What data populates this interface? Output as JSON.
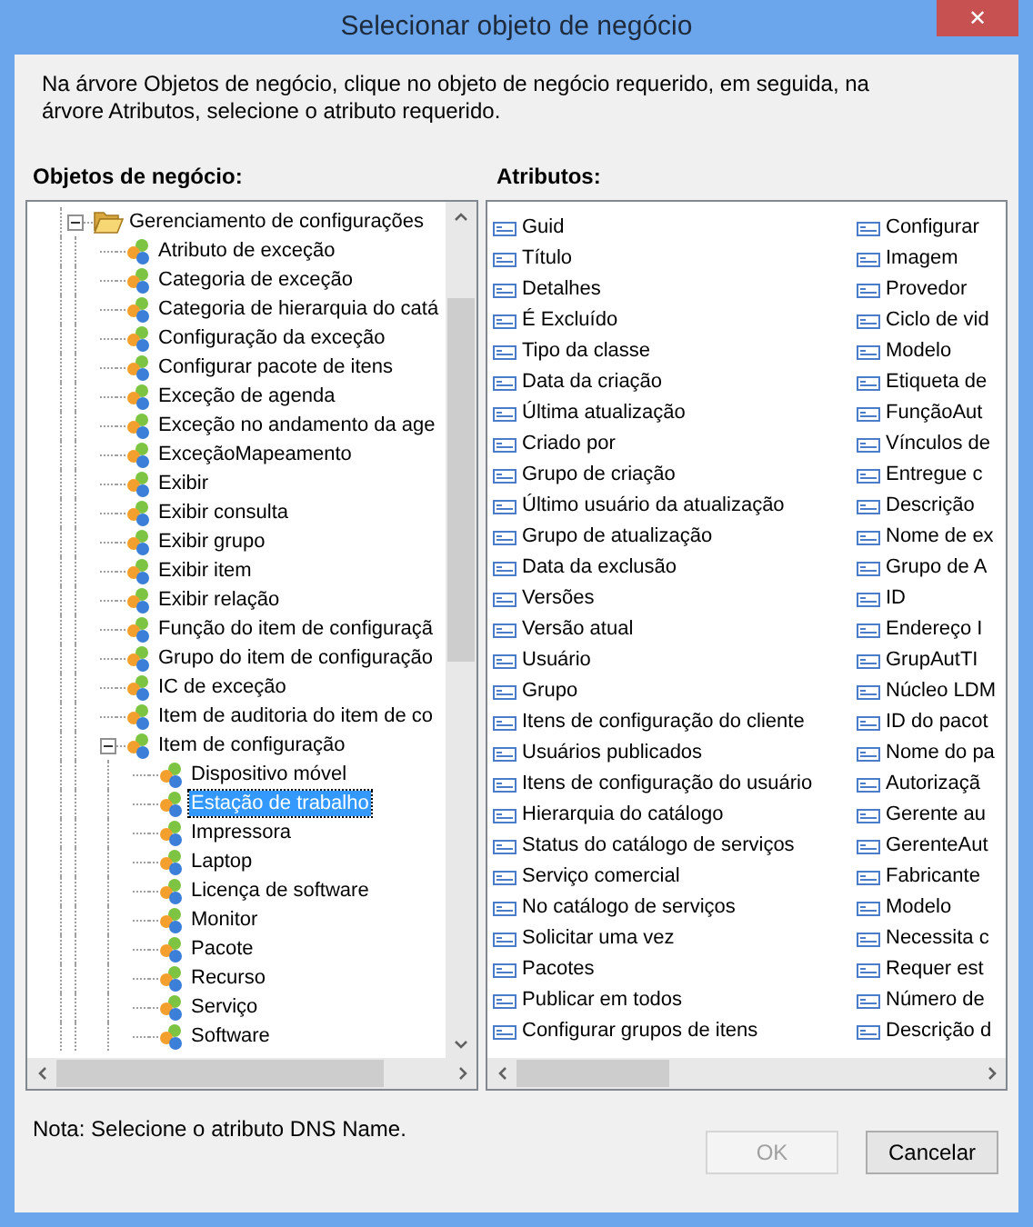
{
  "window": {
    "title": "Selecionar objeto de negócio",
    "close": "✕"
  },
  "instructions": "Na árvore Objetos de negócio, clique no objeto de negócio requerido, em seguida, na árvore Atributos, selecione o atributo requerido.",
  "business_objects": {
    "label": "Objetos de negócio:",
    "tree": [
      {
        "label": "Gerenciamento de configurações",
        "kind": "folder",
        "expanded": true,
        "selected": false,
        "children": [
          {
            "label": "Atributo de exceção",
            "kind": "object",
            "selected": false
          },
          {
            "label": "Categoria de exceção",
            "kind": "object",
            "selected": false
          },
          {
            "label": "Categoria de hierarquia do catá",
            "kind": "object",
            "selected": false
          },
          {
            "label": "Configuração da exceção",
            "kind": "object",
            "selected": false
          },
          {
            "label": "Configurar pacote de itens",
            "kind": "object",
            "selected": false
          },
          {
            "label": "Exceção de agenda",
            "kind": "object",
            "selected": false
          },
          {
            "label": "Exceção no andamento da age",
            "kind": "object",
            "selected": false
          },
          {
            "label": "ExceçãoMapeamento",
            "kind": "object",
            "selected": false
          },
          {
            "label": "Exibir",
            "kind": "object",
            "selected": false
          },
          {
            "label": "Exibir consulta",
            "kind": "object",
            "selected": false
          },
          {
            "label": "Exibir grupo",
            "kind": "object",
            "selected": false
          },
          {
            "label": "Exibir item",
            "kind": "object",
            "selected": false
          },
          {
            "label": "Exibir relação",
            "kind": "object",
            "selected": false
          },
          {
            "label": "Função do item de configuraçã",
            "kind": "object",
            "selected": false
          },
          {
            "label": "Grupo do item de configuração",
            "kind": "object",
            "selected": false
          },
          {
            "label": "IC de exceção",
            "kind": "object",
            "selected": false
          },
          {
            "label": "Item de auditoria do item de co",
            "kind": "object",
            "selected": false
          },
          {
            "label": "Item de configuração",
            "kind": "object",
            "expanded": true,
            "selected": false,
            "children": [
              {
                "label": "Dispositivo móvel",
                "kind": "object",
                "selected": false
              },
              {
                "label": "Estação de trabalho",
                "kind": "object",
                "selected": true
              },
              {
                "label": "Impressora",
                "kind": "object",
                "selected": false
              },
              {
                "label": "Laptop",
                "kind": "object",
                "selected": false
              },
              {
                "label": "Licença de software",
                "kind": "object",
                "selected": false
              },
              {
                "label": "Monitor",
                "kind": "object",
                "selected": false
              },
              {
                "label": "Pacote",
                "kind": "object",
                "selected": false
              },
              {
                "label": "Recurso",
                "kind": "object",
                "selected": false
              },
              {
                "label": "Serviço",
                "kind": "object",
                "selected": false
              },
              {
                "label": "Software",
                "kind": "object",
                "selected": false
              }
            ]
          }
        ]
      }
    ]
  },
  "attributes": {
    "label": "Atributos:",
    "items": [
      "Guid",
      "Título",
      "Detalhes",
      "É Excluído",
      "Tipo da classe",
      "Data da criação",
      "Última atualização",
      "Criado por",
      "Grupo de criação",
      "Último usuário da atualização",
      "Grupo de atualização",
      "Data da exclusão",
      "Versões",
      "Versão atual",
      "Usuário",
      "Grupo",
      "Itens de configuração do cliente",
      "Usuários publicados",
      "Itens de configuração do usuário",
      "Hierarquia do catálogo",
      "Status do catálogo de serviços",
      "Serviço comercial",
      "No catálogo de serviços",
      "Solicitar uma vez",
      "Pacotes",
      "Publicar em todos",
      "Configurar grupos de itens",
      "Configurar",
      "Imagem",
      "Provedor",
      "Ciclo de vid",
      "Modelo",
      "Etiqueta de",
      "FunçãoAut",
      "Vínculos de",
      "Entregue c",
      "Descrição",
      "Nome de ex",
      "Grupo de A",
      "ID",
      "Endereço I",
      "GrupAutTI",
      "Núcleo LDM",
      "ID do pacot",
      "Nome do pa",
      "Autorizaçã",
      "Gerente au",
      "GerenteAut",
      "Fabricante",
      "Modelo",
      "Necessita c",
      "Requer est",
      "Número de",
      "Descrição d"
    ]
  },
  "note": "Nota: Selecione o atributo DNS Name.",
  "buttons": [
    {
      "label": "OK",
      "disabled": true
    },
    {
      "label": "Cancelar",
      "disabled": false
    }
  ]
}
